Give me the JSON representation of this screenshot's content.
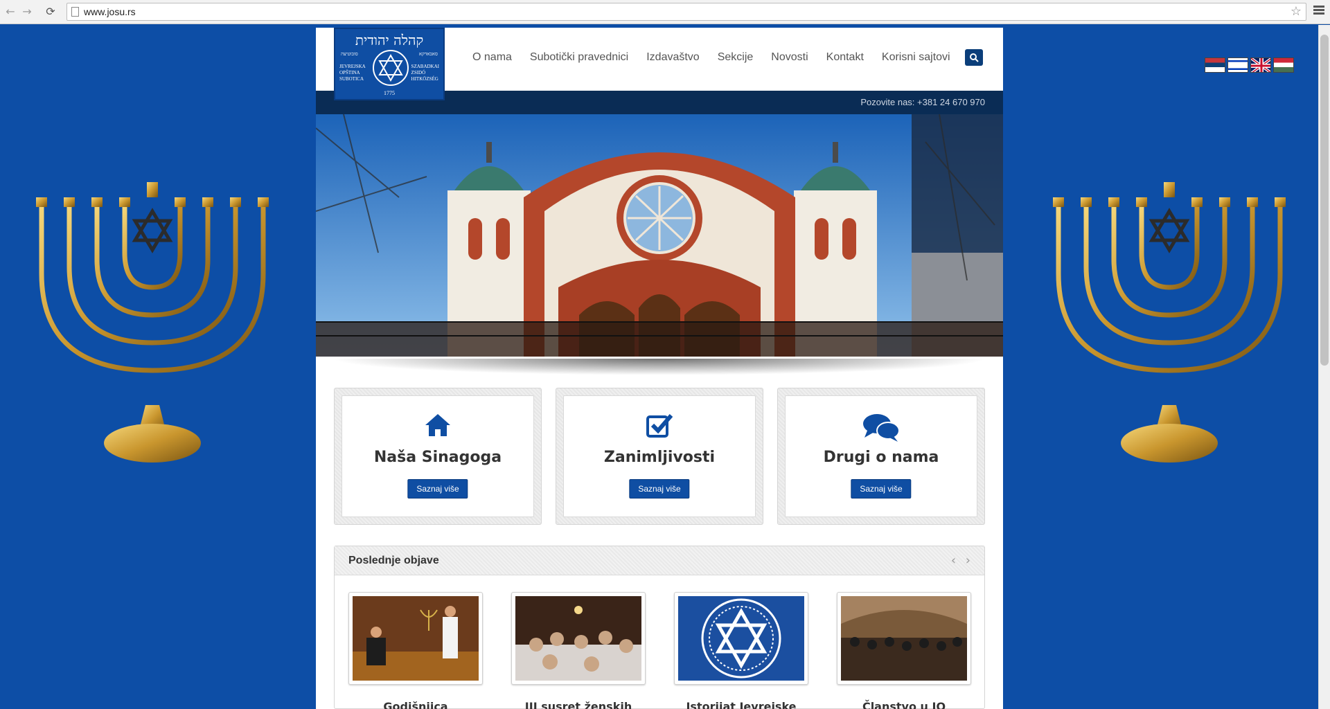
{
  "browser": {
    "url": "www.josu.rs",
    "back_glyph": "←",
    "forward_glyph": "→",
    "reload_glyph": "⟳",
    "star_glyph": "☆"
  },
  "logo": {
    "hebrew_title": "קהלה יהודית",
    "left_hebrew": "סובוטיצה",
    "right_hebrew": "סאבאדקא",
    "left_lines": [
      "JEVREJSKA",
      "OPŠTINA",
      "SUBOTICA"
    ],
    "right_lines": [
      "SZABADKAI",
      "ZSIDÓ",
      "HITKÖZSÉG"
    ],
    "year": "1775"
  },
  "nav": {
    "items": [
      "O nama",
      "Subotički pravednici",
      "Izdavaštvo",
      "Sekcije",
      "Novosti",
      "Kontakt",
      "Korisni sajtovi"
    ]
  },
  "phone": "Pozovite nas: +381 24 670 970",
  "features": [
    {
      "title": "Naša Sinagoga",
      "button": "Saznaj više",
      "icon": "home-icon"
    },
    {
      "title": "Zanimljivosti",
      "button": "Saznaj više",
      "icon": "check-square-icon"
    },
    {
      "title": "Drugi o nama",
      "button": "Saznaj više",
      "icon": "comments-icon"
    }
  ],
  "recent": {
    "title": "Poslednje objave",
    "arrows": "‹ ›",
    "posts": [
      {
        "title": "Godišnjica"
      },
      {
        "title": "III susret ženskih"
      },
      {
        "title": "Istorijat Jevrejske"
      },
      {
        "title": "Članstvo u JO"
      }
    ]
  },
  "colors": {
    "background": "#0d4ea6",
    "accent": "#0f4ea3",
    "phone_bar": "#0a2c55"
  }
}
